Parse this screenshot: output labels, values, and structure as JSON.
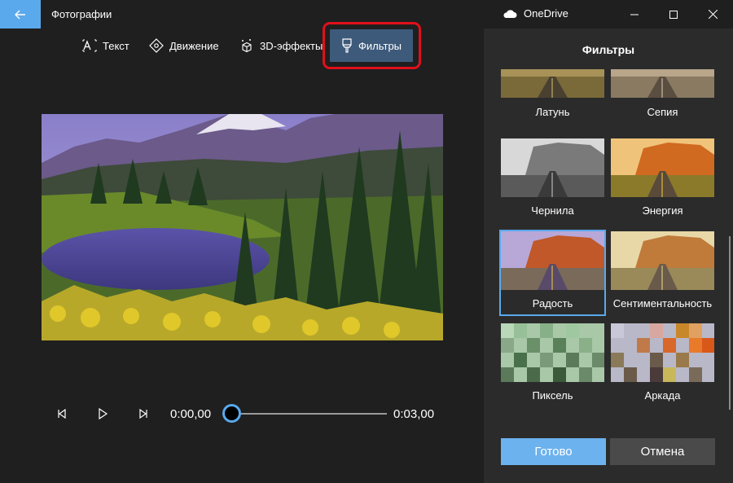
{
  "titlebar": {
    "app_title": "Фотографии",
    "onedrive_label": "OneDrive"
  },
  "toolbar": {
    "text_label": "Текст",
    "motion_label": "Движение",
    "effects3d_label": "3D-эффекты",
    "filters_label": "Фильтры"
  },
  "playback": {
    "current_time": "0:00,00",
    "total_time": "0:03,00",
    "progress": 0
  },
  "panel": {
    "title": "Фильтры",
    "filters": [
      {
        "label": "Латунь"
      },
      {
        "label": "Сепия"
      },
      {
        "label": "Чернила"
      },
      {
        "label": "Энергия"
      },
      {
        "label": "Радость",
        "selected": true
      },
      {
        "label": "Сентиментальность"
      },
      {
        "label": "Пиксель"
      },
      {
        "label": "Аркада"
      }
    ],
    "done_label": "Готово",
    "cancel_label": "Отмена"
  },
  "colors": {
    "accent": "#5aa9ec",
    "active_tool": "#3d5a7a",
    "highlight": "#e0101a"
  }
}
